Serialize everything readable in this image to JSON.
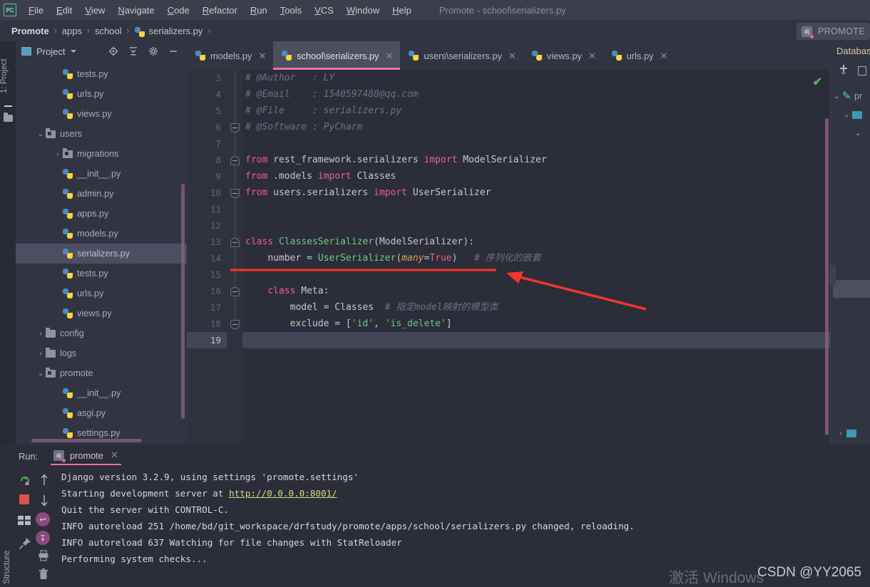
{
  "window": {
    "title": "Promote - school\\serializers.py",
    "app_logo": "PC"
  },
  "menubar": {
    "items": [
      {
        "label": "File",
        "mnemonic": "F"
      },
      {
        "label": "Edit",
        "mnemonic": "E"
      },
      {
        "label": "View",
        "mnemonic": "V"
      },
      {
        "label": "Navigate",
        "mnemonic": "N"
      },
      {
        "label": "Code",
        "mnemonic": "C"
      },
      {
        "label": "Refactor",
        "mnemonic": "R"
      },
      {
        "label": "Run",
        "mnemonic": "R"
      },
      {
        "label": "Tools",
        "mnemonic": "T"
      },
      {
        "label": "VCS",
        "mnemonic": "V"
      },
      {
        "label": "Window",
        "mnemonic": "W"
      },
      {
        "label": "Help",
        "mnemonic": "H"
      }
    ]
  },
  "breadcrumb": {
    "items": [
      "Promote",
      "apps",
      "school",
      "serializers.py"
    ],
    "separator": "›"
  },
  "run_config_chip": {
    "label": "PROMOTE",
    "icon": "django-icon",
    "badge": "dj"
  },
  "left_strip": {
    "tab_label": "1: Project",
    "folder_icon": "folder-icon"
  },
  "project_panel": {
    "title": "Project",
    "tools": [
      "locate-icon",
      "collapse-all-icon",
      "settings-gear-icon",
      "minimize-icon"
    ],
    "tree": [
      {
        "label": "tests.py",
        "indent": 2,
        "type": "py",
        "arrow": "",
        "selected": false
      },
      {
        "label": "urls.py",
        "indent": 2,
        "type": "py",
        "arrow": "",
        "selected": false
      },
      {
        "label": "views.py",
        "indent": 2,
        "type": "py",
        "arrow": "",
        "selected": false
      },
      {
        "label": "users",
        "indent": 1,
        "type": "module",
        "arrow": "⌄",
        "selected": false
      },
      {
        "label": "migrations",
        "indent": 2,
        "type": "module",
        "arrow": "›",
        "selected": false
      },
      {
        "label": "__init__.py",
        "indent": 2,
        "type": "py",
        "arrow": "",
        "selected": false
      },
      {
        "label": "admin.py",
        "indent": 2,
        "type": "py",
        "arrow": "",
        "selected": false
      },
      {
        "label": "apps.py",
        "indent": 2,
        "type": "py",
        "arrow": "",
        "selected": false
      },
      {
        "label": "models.py",
        "indent": 2,
        "type": "py",
        "arrow": "",
        "selected": false
      },
      {
        "label": "serializers.py",
        "indent": 2,
        "type": "py",
        "arrow": "",
        "selected": true
      },
      {
        "label": "tests.py",
        "indent": 2,
        "type": "py",
        "arrow": "",
        "selected": false
      },
      {
        "label": "urls.py",
        "indent": 2,
        "type": "py",
        "arrow": "",
        "selected": false
      },
      {
        "label": "views.py",
        "indent": 2,
        "type": "py",
        "arrow": "",
        "selected": false
      },
      {
        "label": "config",
        "indent": 1,
        "type": "folder",
        "arrow": "›",
        "selected": false
      },
      {
        "label": "logs",
        "indent": 1,
        "type": "folder",
        "arrow": "›",
        "selected": false
      },
      {
        "label": "promote",
        "indent": 1,
        "type": "module",
        "arrow": "⌄",
        "selected": false
      },
      {
        "label": "__init__.py",
        "indent": 2,
        "type": "py",
        "arrow": "",
        "selected": false
      },
      {
        "label": "asgi.py",
        "indent": 2,
        "type": "py",
        "arrow": "",
        "selected": false
      },
      {
        "label": "settings.py",
        "indent": 2,
        "type": "py",
        "arrow": "",
        "selected": false
      }
    ]
  },
  "editor": {
    "tabs": [
      {
        "label": "models.py",
        "active": false
      },
      {
        "label": "school\\serializers.py",
        "active": true
      },
      {
        "label": "users\\serializers.py",
        "active": false
      },
      {
        "label": "views.py",
        "active": false
      },
      {
        "label": "urls.py",
        "active": false
      }
    ],
    "first_line_number": 3,
    "current_line": 19,
    "inspection_status": "ok",
    "lines": [
      {
        "n": 3,
        "text": "# @Author   : LY"
      },
      {
        "n": 4,
        "text": "# @Email    : 1540597488@qq.com"
      },
      {
        "n": 5,
        "text": "# @File     : serializers.py"
      },
      {
        "n": 6,
        "text": "# @Software : PyCharm"
      },
      {
        "n": 7,
        "text": ""
      },
      {
        "n": 8,
        "text": "from rest_framework.serializers import ModelSerializer"
      },
      {
        "n": 9,
        "text": "from .models import Classes"
      },
      {
        "n": 10,
        "text": "from users.serializers import UserSerializer"
      },
      {
        "n": 11,
        "text": ""
      },
      {
        "n": 12,
        "text": ""
      },
      {
        "n": 13,
        "text": "class ClassesSerializer(ModelSerializer):"
      },
      {
        "n": 14,
        "text": "    number = UserSerializer(many=True)   # 序列化的嵌套"
      },
      {
        "n": 15,
        "text": ""
      },
      {
        "n": 16,
        "text": "    class Meta:"
      },
      {
        "n": 17,
        "text": "        model = Classes  # 指定model映射的模型类"
      },
      {
        "n": 18,
        "text": "        exclude = ['id', 'is_delete']"
      },
      {
        "n": 19,
        "text": ""
      }
    ],
    "annotation": {
      "underline_color": "#f0352e",
      "arrow_color": "#f0352e",
      "underlined_line": 14
    }
  },
  "database_panel": {
    "title": "Database",
    "tools": [
      "add-plus-icon",
      "copy-icon"
    ],
    "rows": [
      "pr",
      "",
      ""
    ]
  },
  "run_panel": {
    "label": "Run:",
    "tab_name": "promote",
    "side_icons": [
      "rerun-icon",
      "stop-icon",
      "scroll-up-icon",
      "scroll-down-icon",
      "layout-icon",
      "soft-wrap-icon",
      "scroll-to-end-icon",
      "pin-icon",
      "print-icon",
      "trash-icon"
    ],
    "console": [
      "Django version 3.2.9, using settings 'promote.settings'",
      "Starting development server at http://0.0.0.0:8001/",
      "Quit the server with CONTROL-C.",
      "INFO autoreload 251 /home/bd/git_workspace/drfstudy/promote/apps/school/serializers.py changed, reloading.",
      "INFO autoreload 637 Watching for file changes with StatReloader",
      "Performing system checks..."
    ],
    "link_text": "http://0.0.0.0:8001/",
    "structure_tab": "Structure"
  },
  "watermarks": {
    "windows": "激活 Windows",
    "csdn": "CSDN @YY2065"
  },
  "colors": {
    "accent_pink": "#f06eb0",
    "annotation_red": "#f0352e",
    "keyword": "#ef5f8e",
    "string_green": "#6ac98b",
    "comment": "#6c7184",
    "param_orange": "#d8a25c",
    "editor_bg": "#2b2d38",
    "panel_bg": "#313541",
    "selection": "#4b4f61"
  }
}
